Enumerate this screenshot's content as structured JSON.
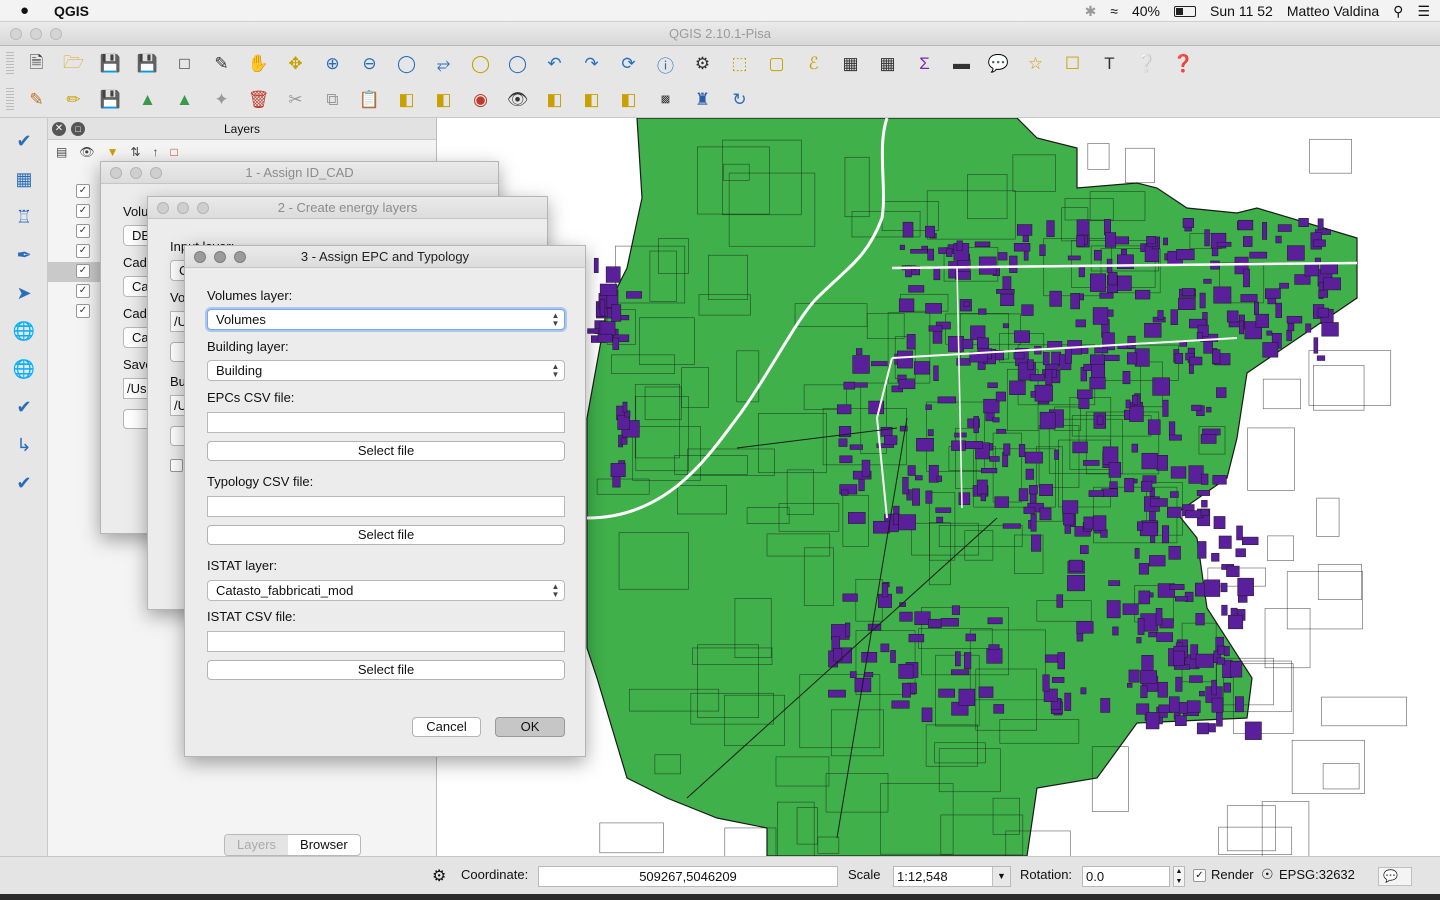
{
  "menubar": {
    "apple": "",
    "app_name": "QGIS",
    "battery": "40%",
    "clock": "Sun 11 52",
    "user": "Matteo Valdina"
  },
  "window": {
    "title": "QGIS 2.10.1-Pisa"
  },
  "layers_panel": {
    "title": "Layers",
    "tabs": [
      "Layers",
      "Browser"
    ]
  },
  "dialog1": {
    "title": "1 - Assign ID_CAD",
    "fragments": [
      "Volu",
      "DB",
      "Cad",
      "Ca",
      "Cad",
      "Ca",
      "Save",
      "/Use"
    ]
  },
  "dialog2": {
    "title": "2 - Create energy layers",
    "fragments": [
      "Input layer:",
      "C",
      "Vo",
      "/U",
      "Bu",
      "/U"
    ]
  },
  "dialog3": {
    "title": "3 - Assign EPC and Typology",
    "volumes_label": "Volumes layer:",
    "volumes_value": "Volumes",
    "building_label": "Building layer:",
    "building_value": "Building",
    "epcs_label": "EPCs CSV file:",
    "epcs_value": "",
    "select_file": "Select file",
    "typology_label": "Typology CSV file:",
    "typology_value": "",
    "istat_layer_label": "ISTAT layer:",
    "istat_layer_value": "Catasto_fabbricati_mod",
    "istat_csv_label": "ISTAT CSV file:",
    "istat_csv_value": "",
    "cancel": "Cancel",
    "ok": "OK"
  },
  "statusbar": {
    "coordinate_label": "Coordinate:",
    "coordinate_value": "509267,5046209",
    "scale_label": "Scale",
    "scale_value": "1:12,548",
    "rotation_label": "Rotation:",
    "rotation_value": "0.0",
    "render_label": "Render",
    "crs": "EPSG:32632"
  },
  "colors": {
    "parcels": "#3fb04a",
    "buildings": "#5a1f9a",
    "roads": "#ffffff",
    "outline": "#1a1a1a"
  }
}
